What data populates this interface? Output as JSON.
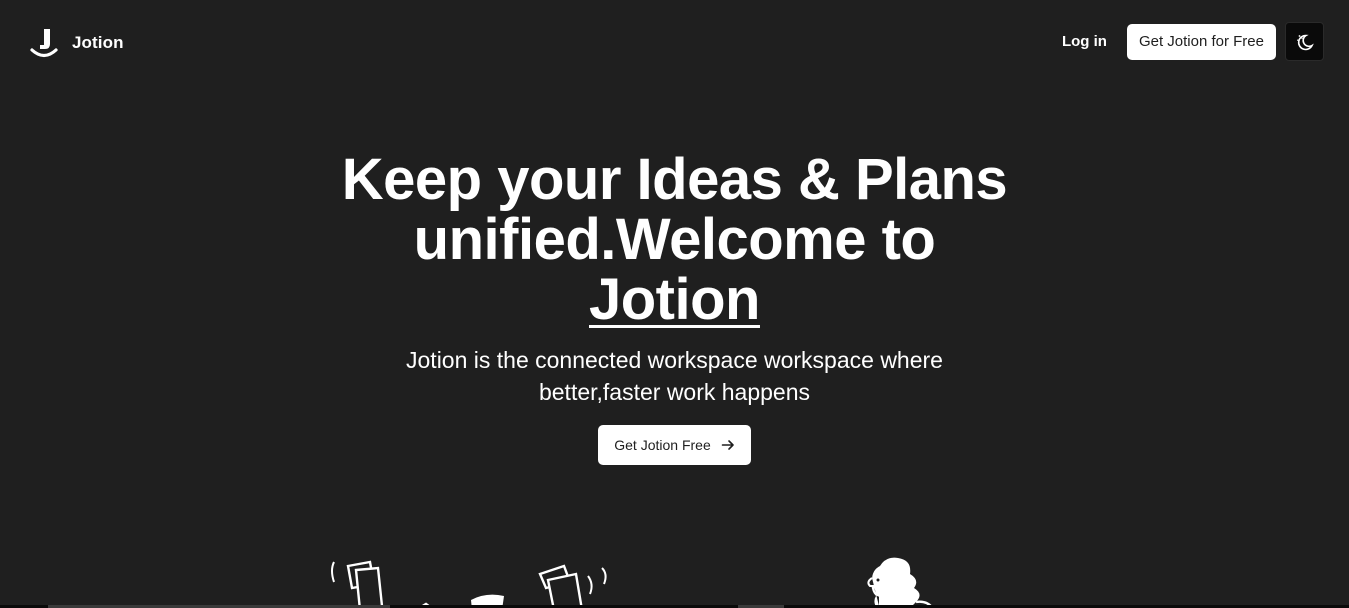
{
  "navbar": {
    "brand_name": "Jotion",
    "login_label": "Log in",
    "cta_label": "Get Jotion for Free",
    "theme_toggle_icon": "moon-stars-icon"
  },
  "hero": {
    "title_line": "Keep your Ideas & Plans unified.Welcome to",
    "title_brand": "Jotion",
    "subtitle": "Jotion is the connected workspace workspace where better,faster work happens",
    "cta_label": "Get Jotion Free",
    "cta_icon": "arrow-right-icon"
  },
  "colors": {
    "background": "#1f1f1f",
    "text": "#ffffff",
    "button_bg": "#ffffff",
    "button_text": "#1f1f1f",
    "toggle_bg": "#0a0a0a"
  }
}
